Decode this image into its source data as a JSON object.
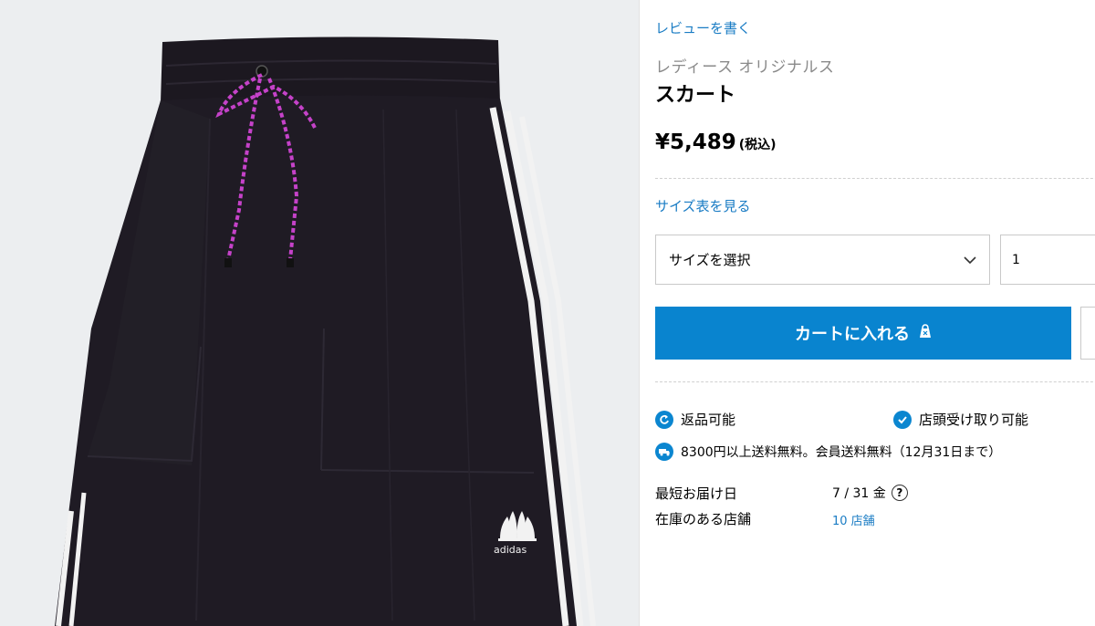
{
  "product": {
    "review_link": "レビューを書く",
    "category": "レディース オリジナルス",
    "name": "スカート",
    "price": "¥5,489",
    "tax_note": "(税込)",
    "brand_logo_text": "adidas"
  },
  "purchase": {
    "size_chart_link": "サイズ表を見る",
    "size_select_value": "サイズを選択",
    "quantity_value": "1",
    "add_to_cart_label": "カートに入れる"
  },
  "features": {
    "returns": "返品可能",
    "store_pickup": "店頭受け取り可能",
    "shipping_note": "8300円以上送料無料。会員送料無料（12月31日まで）"
  },
  "delivery": {
    "earliest_label": "最短お届け日",
    "earliest_value": "7 / 31 金",
    "stock_label": "在庫のある店舗",
    "stock_value": "10 店舗"
  },
  "colors": {
    "accent": "#0984cf",
    "link": "#1a7cc4",
    "image_bg": "#eceef0",
    "skirt": "#1f1b24",
    "drawstring": "#c542c9"
  },
  "icons": [
    "chevron-down-icon",
    "shopping-bag-icon",
    "return-icon",
    "check-icon",
    "delivery-truck-icon",
    "question-icon"
  ]
}
